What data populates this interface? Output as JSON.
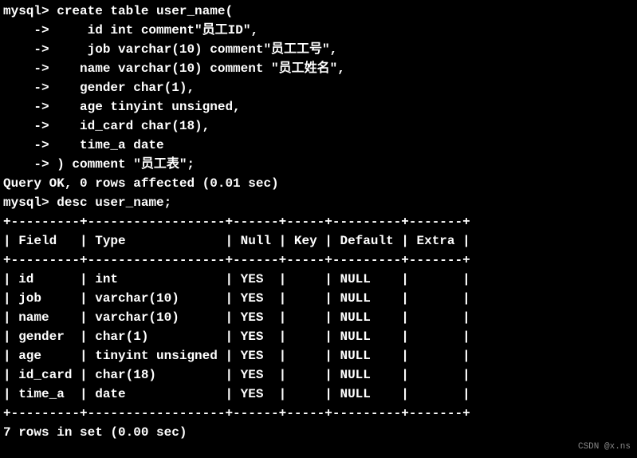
{
  "prompt1": "mysql> ",
  "create_lines": [
    "create table user_name(",
    "    ->     id int comment\"员工ID\",",
    "    ->     job varchar(10) comment\"员工工号\",",
    "    ->    name varchar(10) comment \"员工姓名\",",
    "    ->    gender char(1),",
    "    ->    age tinyint unsigned,",
    "    ->    id_card char(18),",
    "    ->    time_a date",
    "    -> ) comment \"员工表\";"
  ],
  "query_ok": "Query OK, 0 rows affected (0.01 sec)",
  "blank": "",
  "prompt2": "mysql> ",
  "desc_cmd": "desc user_name;",
  "table": {
    "border_top": "+---------+------------------+------+-----+---------+-------+",
    "header": "| Field   | Type             | Null | Key | Default | Extra |",
    "border_mid": "+---------+------------------+------+-----+---------+-------+",
    "rows": [
      "| id      | int              | YES  |     | NULL    |       |",
      "| job     | varchar(10)      | YES  |     | NULL    |       |",
      "| name    | varchar(10)      | YES  |     | NULL    |       |",
      "| gender  | char(1)          | YES  |     | NULL    |       |",
      "| age     | tinyint unsigned | YES  |     | NULL    |       |",
      "| id_card | char(18)         | YES  |     | NULL    |       |",
      "| time_a  | date             | YES  |     | NULL    |       |"
    ],
    "border_bot": "+---------+------------------+------+-----+---------+-------+"
  },
  "rows_in_set": "7 rows in set (0.00 sec)",
  "watermark": "CSDN @x.ns",
  "chart_data": {
    "type": "table",
    "title": "desc user_name",
    "columns": [
      "Field",
      "Type",
      "Null",
      "Key",
      "Default",
      "Extra"
    ],
    "rows": [
      {
        "Field": "id",
        "Type": "int",
        "Null": "YES",
        "Key": "",
        "Default": "NULL",
        "Extra": ""
      },
      {
        "Field": "job",
        "Type": "varchar(10)",
        "Null": "YES",
        "Key": "",
        "Default": "NULL",
        "Extra": ""
      },
      {
        "Field": "name",
        "Type": "varchar(10)",
        "Null": "YES",
        "Key": "",
        "Default": "NULL",
        "Extra": ""
      },
      {
        "Field": "gender",
        "Type": "char(1)",
        "Null": "YES",
        "Key": "",
        "Default": "NULL",
        "Extra": ""
      },
      {
        "Field": "age",
        "Type": "tinyint unsigned",
        "Null": "YES",
        "Key": "",
        "Default": "NULL",
        "Extra": ""
      },
      {
        "Field": "id_card",
        "Type": "char(18)",
        "Null": "YES",
        "Key": "",
        "Default": "NULL",
        "Extra": ""
      },
      {
        "Field": "time_a",
        "Type": "date",
        "Null": "YES",
        "Key": "",
        "Default": "NULL",
        "Extra": ""
      }
    ]
  }
}
